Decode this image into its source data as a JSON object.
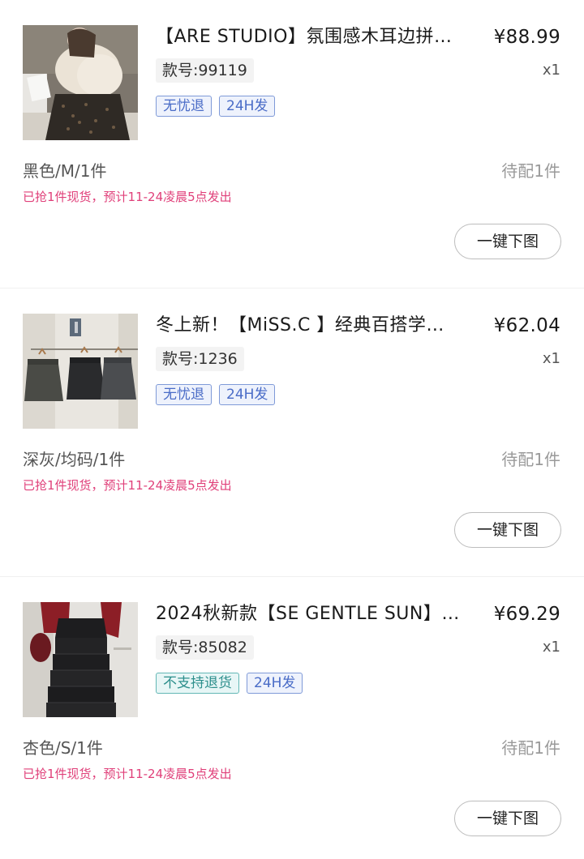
{
  "orders": [
    {
      "title": "【ARE STUDIO】氛围感木耳边拼…",
      "price": "¥88.99",
      "quantity": "x1",
      "sku": "款号:99119",
      "tags": [
        {
          "label": "无忧退"
        },
        {
          "label": "24H发"
        }
      ],
      "spec": "黑色/M/1件",
      "status": "待配1件",
      "stock_note": "已抢1件现货，预计11-24凌晨5点发出",
      "action": "一键下图"
    },
    {
      "title": "冬上新！【MiSS.C 】经典百搭学…",
      "price": "¥62.04",
      "quantity": "x1",
      "sku": "款号:1236",
      "tags": [
        {
          "label": "无忧退"
        },
        {
          "label": "24H发"
        }
      ],
      "spec": "深灰/均码/1件",
      "status": "待配1件",
      "stock_note": "已抢1件现货，预计11-24凌晨5点发出",
      "action": "一键下图"
    },
    {
      "title": "2024秋新款【SE GENTLE SUN】…",
      "price": "¥69.29",
      "quantity": "x1",
      "sku": "款号:85082",
      "tags": [
        {
          "label": "不支持退货",
          "color": "#2d8f8c"
        },
        {
          "label": "24H发"
        }
      ],
      "spec": "杏色/S/1件",
      "status": "待配1件",
      "stock_note": "已抢1件现货，预计11-24凌晨5点发出",
      "action": "一键下图"
    }
  ],
  "colors": {
    "tag_blue": "#4a6cc7",
    "tag_teal": "#2d8f8c",
    "stock_pink": "#e0407a",
    "status_gray": "#9a9a9a"
  }
}
